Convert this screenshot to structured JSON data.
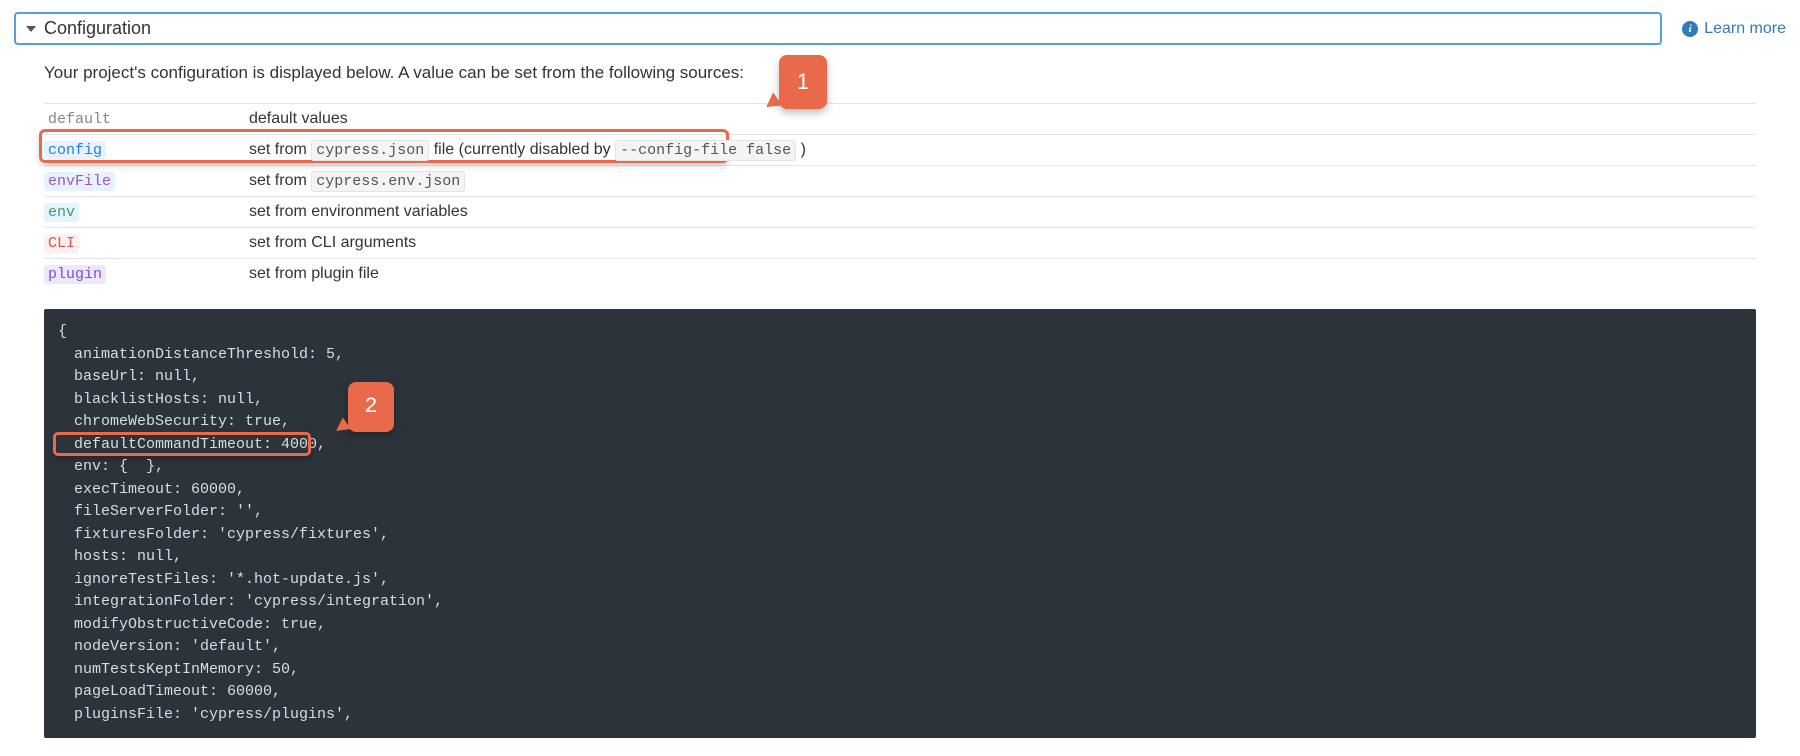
{
  "header": {
    "title": "Configuration",
    "learn_more_label": "Learn more"
  },
  "intro": "Your project's configuration is displayed below. A value can be set from the following sources:",
  "sources": [
    {
      "key": "default",
      "keyClass": "k-default",
      "pre": "default values",
      "code": "",
      "post": ""
    },
    {
      "key": "config",
      "keyClass": "k-config",
      "pre": "set from ",
      "code": "cypress.json",
      "post": " file (currently disabled by ",
      "code2": "--config-file false",
      "post2": " )"
    },
    {
      "key": "envFile",
      "keyClass": "k-envFile",
      "pre": "set from ",
      "code": "cypress.env.json",
      "post": ""
    },
    {
      "key": "env",
      "keyClass": "k-env",
      "pre": "set from environment variables",
      "code": "",
      "post": ""
    },
    {
      "key": "CLI",
      "keyClass": "k-CLI",
      "pre": "set from CLI arguments",
      "code": "",
      "post": ""
    },
    {
      "key": "plugin",
      "keyClass": "k-plugin",
      "pre": "set from plugin file",
      "code": "",
      "post": ""
    }
  ],
  "config_lines": [
    {
      "prop": "{",
      "val": ""
    },
    {
      "prop": "animationDistanceThreshold:",
      "val": " 5,"
    },
    {
      "prop": "baseUrl:",
      "val": " null,"
    },
    {
      "prop": "blacklistHosts:",
      "val": " null,"
    },
    {
      "prop": "chromeWebSecurity:",
      "val": " true,"
    },
    {
      "prop": "defaultCommandTimeout:",
      "val": " 4000,"
    },
    {
      "prop": "env:",
      "val": " {  },"
    },
    {
      "prop": "execTimeout:",
      "val": " 60000,"
    },
    {
      "prop": "fileServerFolder:",
      "val": " '',"
    },
    {
      "prop": "fixturesFolder:",
      "val": " 'cypress/fixtures',"
    },
    {
      "prop": "hosts:",
      "val": " null,"
    },
    {
      "prop": "ignoreTestFiles:",
      "val": " '*.hot-update.js',"
    },
    {
      "prop": "integrationFolder:",
      "val": " 'cypress/integration',"
    },
    {
      "prop": "modifyObstructiveCode:",
      "val": " true,"
    },
    {
      "prop": "nodeVersion:",
      "val": " 'default',"
    },
    {
      "prop": "numTestsKeptInMemory:",
      "val": " 50,"
    },
    {
      "prop": "pageLoadTimeout:",
      "val": " 60000,"
    },
    {
      "prop": "pluginsFile:",
      "val": " 'cypress/plugins',"
    }
  ],
  "callouts": {
    "one": "1",
    "two": "2"
  }
}
